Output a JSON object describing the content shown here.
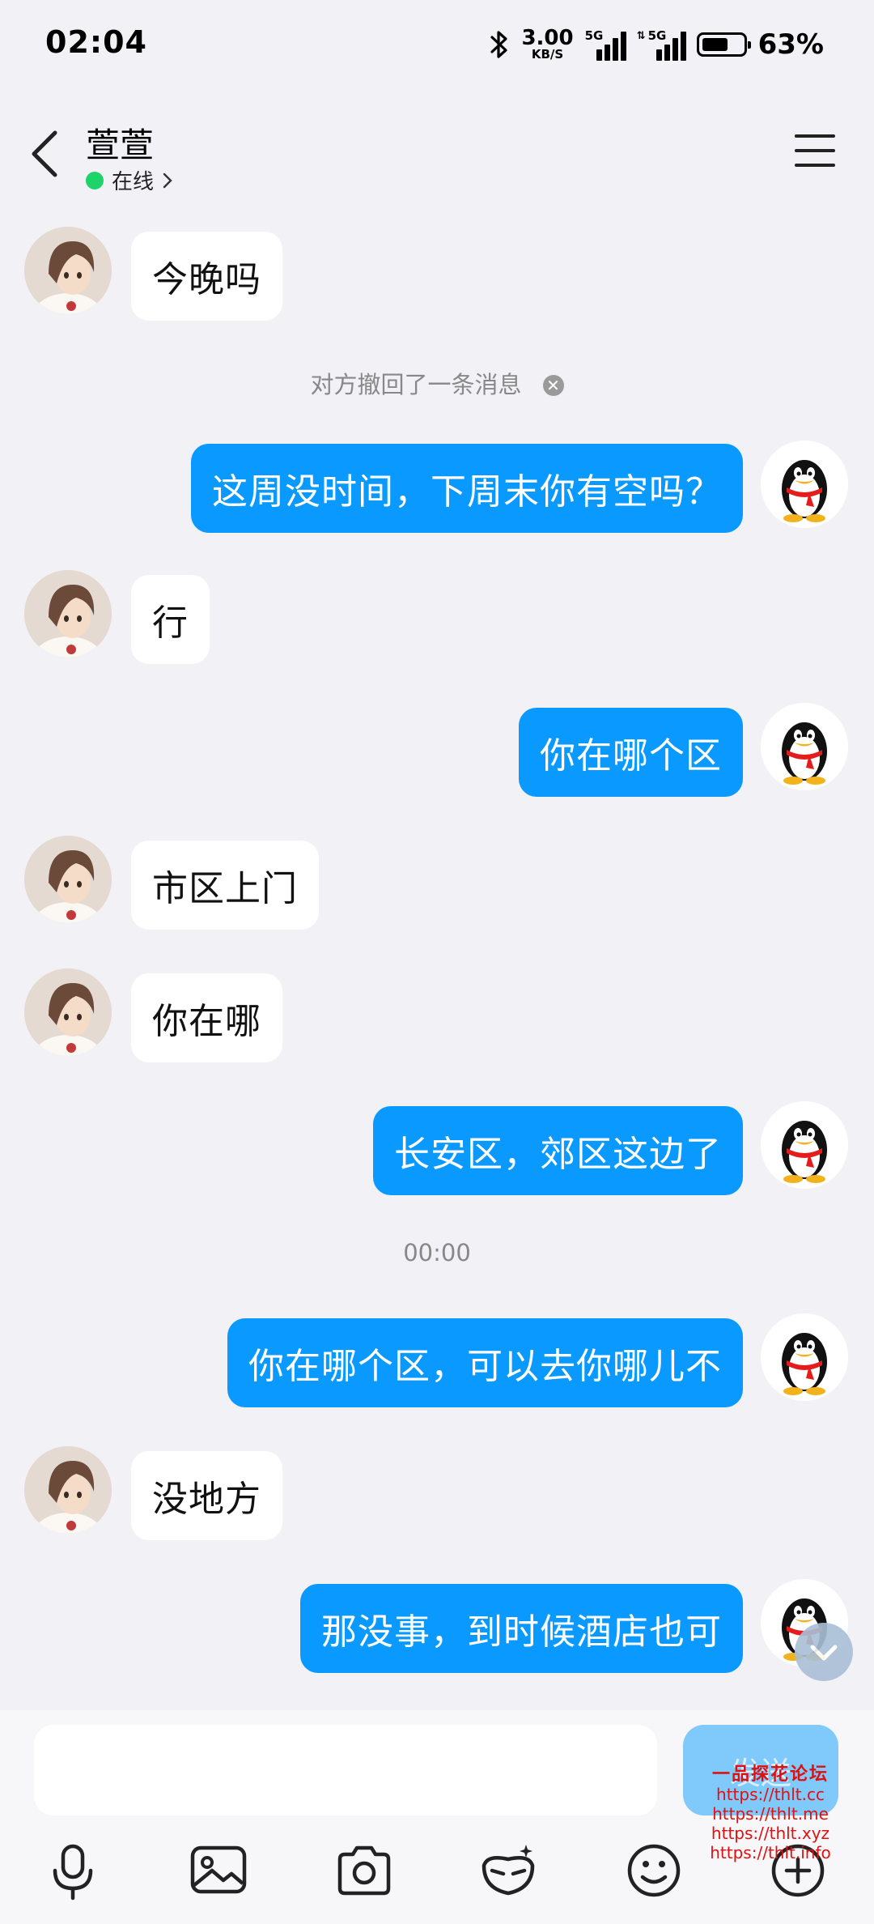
{
  "status_bar": {
    "time": "02:04",
    "net_speed_value": "3.00",
    "net_speed_unit": "KB/S",
    "sim1_label": "5G",
    "sim2_label": "5G",
    "battery_percent": "63%",
    "battery_level": 0.63
  },
  "header": {
    "contact_name": "萱萱",
    "online_status": "在线"
  },
  "messages": [
    {
      "from": "them",
      "text": "今晚吗"
    },
    {
      "system": "对方撤回了一条消息"
    },
    {
      "from": "me",
      "text": "这周没时间，下周末你有空吗？"
    },
    {
      "from": "them",
      "text": "行"
    },
    {
      "from": "me",
      "text": "你在哪个区"
    },
    {
      "from": "them",
      "text": "市区上门"
    },
    {
      "from": "them",
      "text": "你在哪"
    },
    {
      "from": "me",
      "text": "长安区，郊区这边了"
    },
    {
      "timestamp": "00:00"
    },
    {
      "from": "me",
      "text": "你在哪个区，可以去你哪儿不"
    },
    {
      "from": "them",
      "text": "没地方"
    },
    {
      "from": "me",
      "text": "那没事，到时候酒店也可"
    }
  ],
  "composer": {
    "input_value": "",
    "send_label": "发送",
    "tools": [
      "microphone-icon",
      "image-icon",
      "camera-icon",
      "sticker-icon",
      "emoji-icon",
      "plus-icon"
    ]
  },
  "watermark": {
    "title": "一品探花论坛",
    "lines": [
      "https://thlt.cc",
      "https://thlt.me",
      "https://thlt.xyz",
      "https://thlt.info"
    ]
  },
  "colors": {
    "background": "#f2f2f6",
    "outgoing_bubble": "#0a99ff",
    "incoming_bubble": "#ffffff",
    "online_dot": "#1ed46a",
    "send_button": "#80c9fb"
  }
}
